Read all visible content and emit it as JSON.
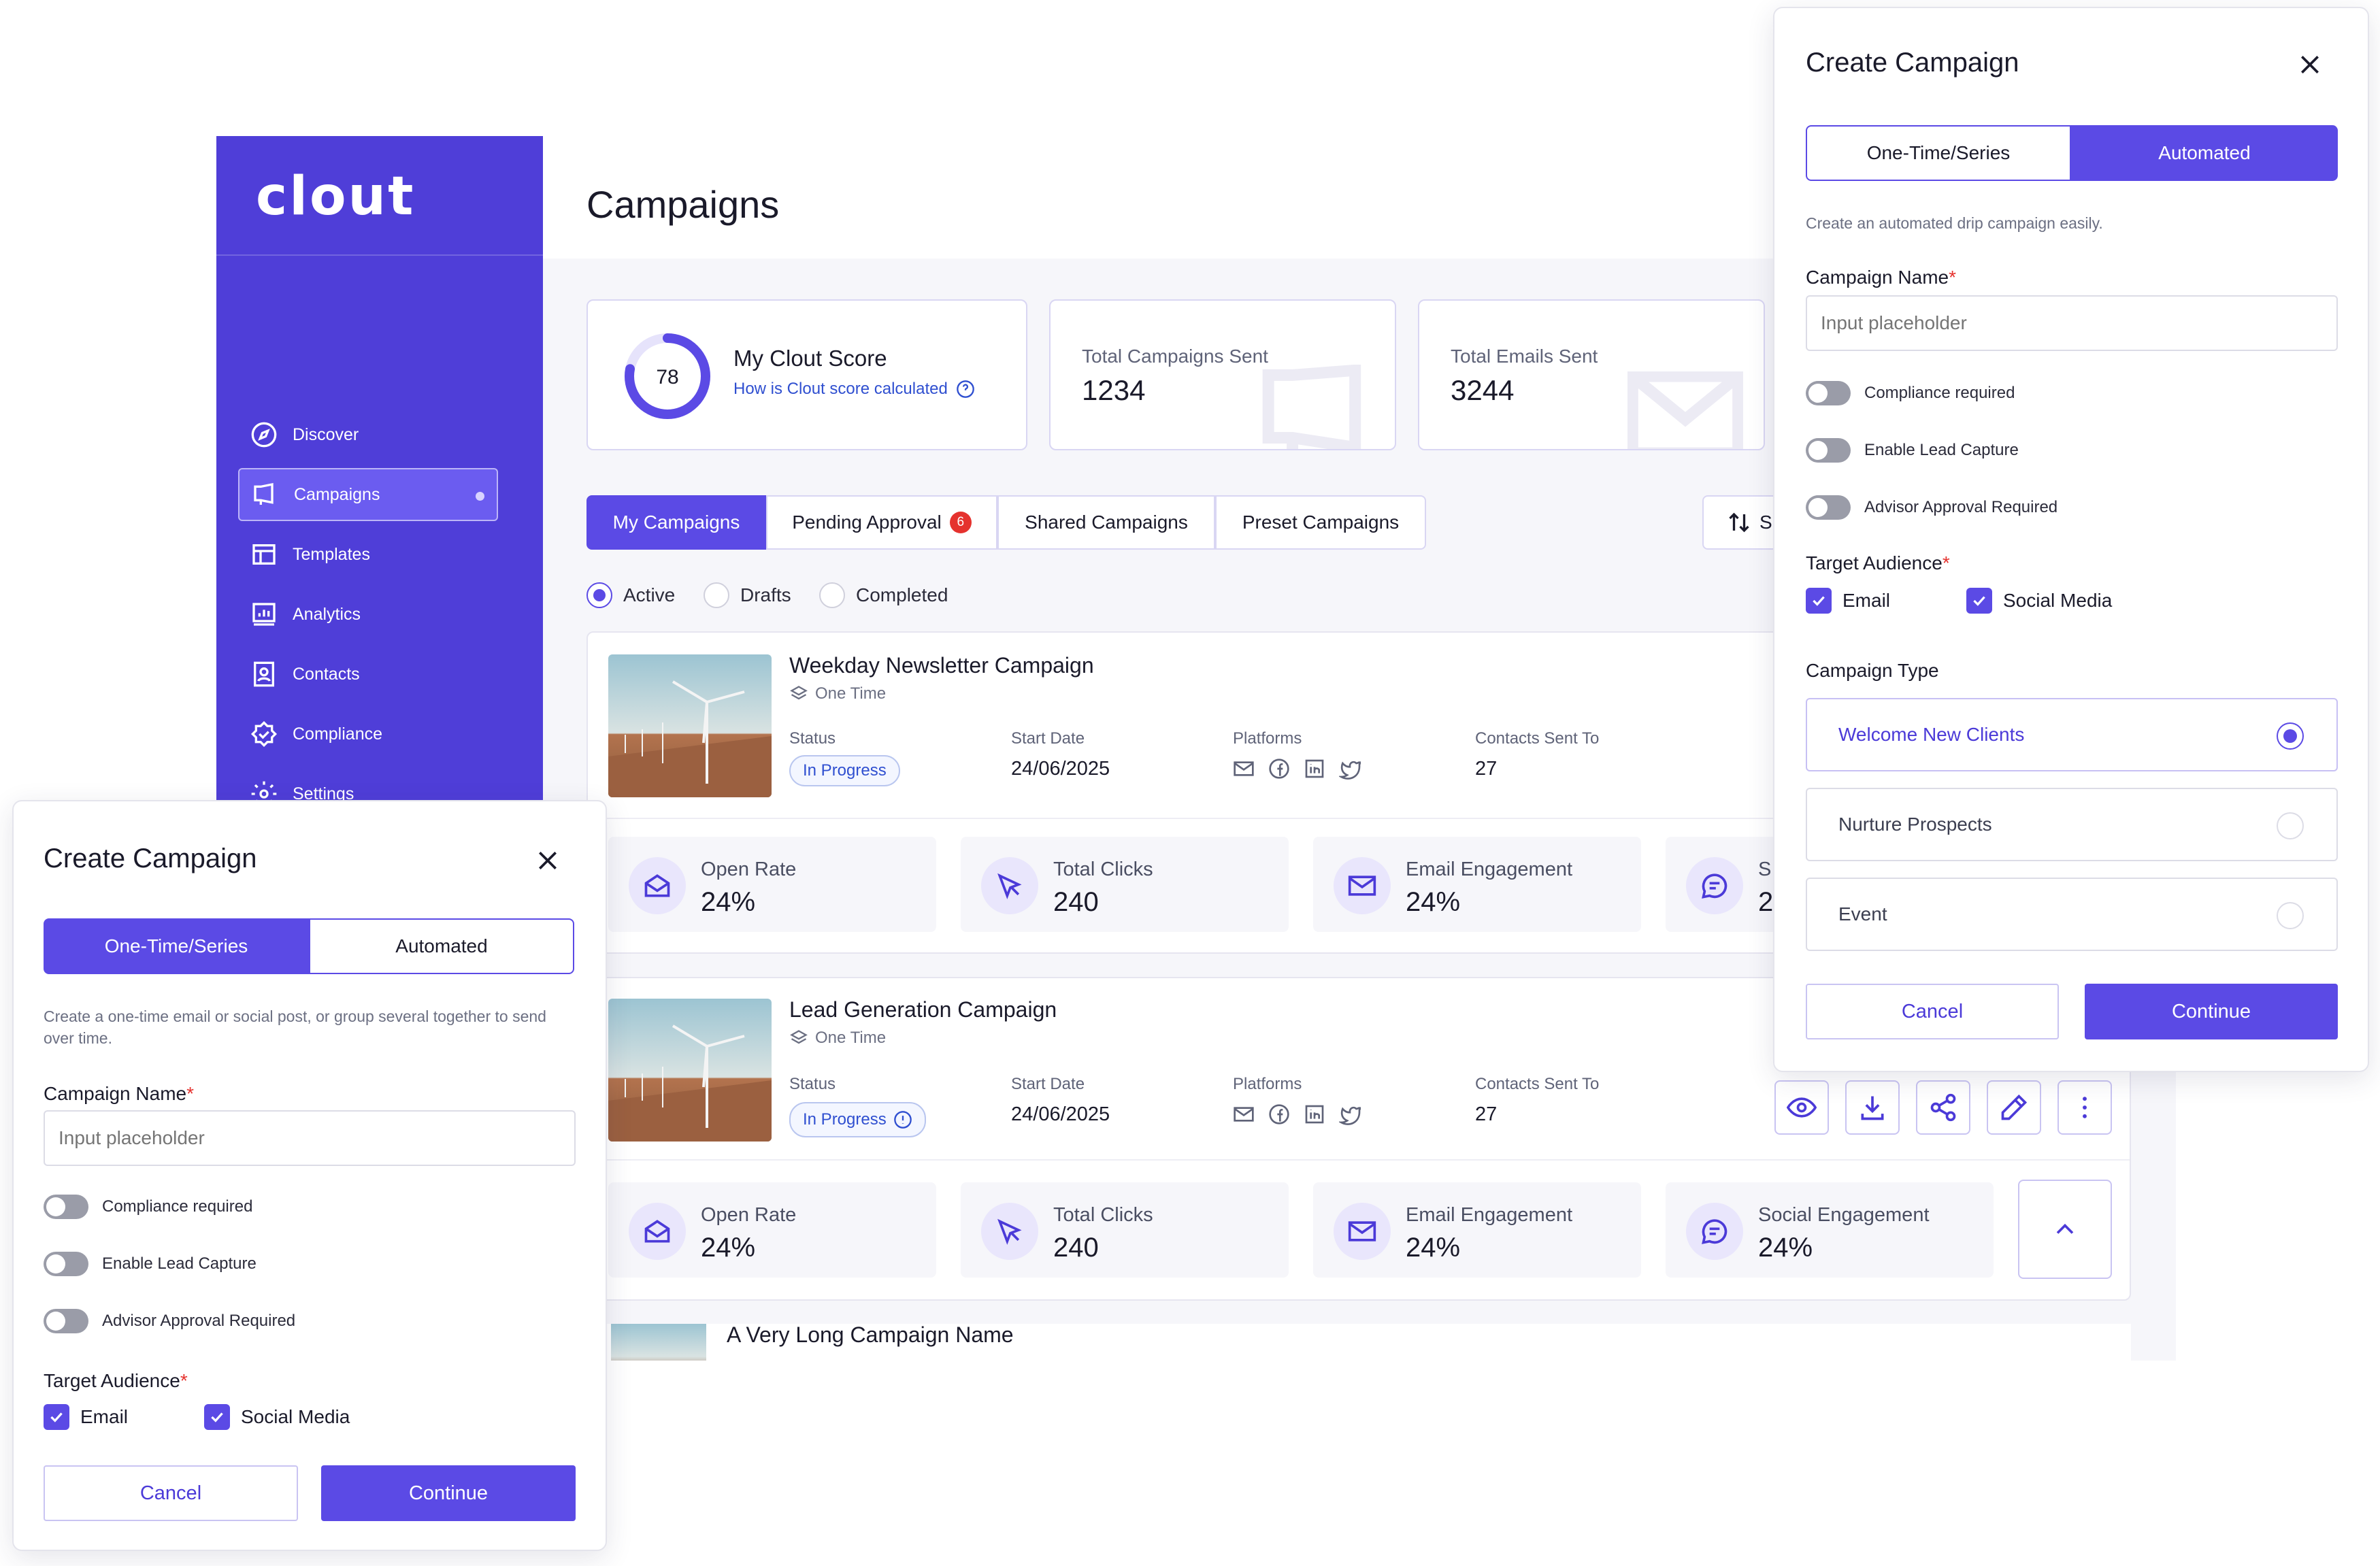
{
  "brand": {
    "logo_text": "clout",
    "accent": "#5b4ae5",
    "sidebar_bg": "#4f3ed8"
  },
  "sidebar": {
    "items": [
      {
        "label": "Discover",
        "icon": "compass-icon"
      },
      {
        "label": "Campaigns",
        "icon": "megaphone-icon",
        "active": true
      },
      {
        "label": "Templates",
        "icon": "layout-icon"
      },
      {
        "label": "Analytics",
        "icon": "chart-icon"
      },
      {
        "label": "Contacts",
        "icon": "contacts-icon"
      },
      {
        "label": "Compliance",
        "icon": "shield-check-icon"
      },
      {
        "label": "Settings",
        "icon": "gear-icon"
      }
    ]
  },
  "page": {
    "title": "Campaigns"
  },
  "stats": {
    "score": {
      "value": "78",
      "title": "My Clout Score",
      "link": "How is Clout score calculated",
      "fraction": 0.78
    },
    "campaigns_sent": {
      "label": "Total Campaigns Sent",
      "value": "1234"
    },
    "emails_sent": {
      "label": "Total Emails Sent",
      "value": "3244"
    }
  },
  "tabs": [
    {
      "label": "My Campaigns",
      "active": true
    },
    {
      "label": "Pending Approval",
      "badge": "6"
    },
    {
      "label": "Shared Campaigns"
    },
    {
      "label": "Preset Campaigns"
    }
  ],
  "sort_button": {
    "label": "S"
  },
  "filters": [
    {
      "label": "Active",
      "selected": true
    },
    {
      "label": "Drafts"
    },
    {
      "label": "Completed"
    }
  ],
  "campaigns": [
    {
      "name": "Weekday Newsletter Campaign",
      "type": "One Time",
      "status_label": "Status",
      "status": "In Progress",
      "start_label": "Start Date",
      "start": "24/06/2025",
      "platforms_label": "Platforms",
      "contacts_label": "Contacts Sent To",
      "contacts": "27",
      "metrics": [
        {
          "label": "Open Rate",
          "value": "24%",
          "icon": "mail-open-icon"
        },
        {
          "label": "Total Clicks",
          "value": "240",
          "icon": "cursor-icon"
        },
        {
          "label": "Email Engagement",
          "value": "24%",
          "icon": "mail-icon"
        },
        {
          "label": "S",
          "value": "2",
          "icon": "chat-icon"
        }
      ]
    },
    {
      "name": "Lead Generation Campaign",
      "type": "One Time",
      "status_label": "Status",
      "status": "In Progress",
      "start_label": "Start Date",
      "start": "24/06/2025",
      "platforms_label": "Platforms",
      "contacts_label": "Contacts Sent To",
      "contacts": "27",
      "metrics": [
        {
          "label": "Open Rate",
          "value": "24%",
          "icon": "mail-open-icon"
        },
        {
          "label": "Total Clicks",
          "value": "240",
          "icon": "cursor-icon"
        },
        {
          "label": "Email Engagement",
          "value": "24%",
          "icon": "mail-icon"
        },
        {
          "label": "Social Engagement",
          "value": "24%",
          "icon": "chat-icon"
        }
      ]
    },
    {
      "name": "A Very Long Campaign Name"
    }
  ],
  "modal_onetime": {
    "title": "Create Campaign",
    "seg_left": "One-Time/Series",
    "seg_right": "Automated",
    "description": "Create a one-time email or social post, or group several together to send over time.",
    "name_label": "Campaign Name",
    "required_mark": "*",
    "name_placeholder": "Input placeholder",
    "toggles": [
      "Compliance required",
      "Enable Lead Capture",
      "Advisor Approval Required"
    ],
    "audience_label": "Target Audience",
    "audience": [
      "Email",
      "Social Media"
    ],
    "cancel": "Cancel",
    "continue": "Continue"
  },
  "modal_automated": {
    "title": "Create Campaign",
    "seg_left": "One-Time/Series",
    "seg_right": "Automated",
    "description": "Create an automated drip campaign easily.",
    "name_label": "Campaign Name",
    "required_mark": "*",
    "name_placeholder": "Input placeholder",
    "toggles": [
      "Compliance required",
      "Enable Lead Capture",
      "Advisor Approval Required"
    ],
    "audience_label": "Target Audience",
    "audience": [
      "Email",
      "Social Media"
    ],
    "type_label": "Campaign Type",
    "types": [
      {
        "label": "Welcome New Clients",
        "selected": true
      },
      {
        "label": "Nurture Prospects"
      },
      {
        "label": "Event"
      }
    ],
    "cancel": "Cancel",
    "continue": "Continue"
  }
}
